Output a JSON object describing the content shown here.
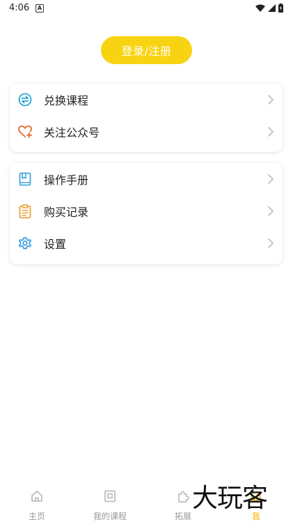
{
  "status_bar": {
    "time": "4:06",
    "notification_badge": "A"
  },
  "login": {
    "label": "登录/注册"
  },
  "card1": {
    "items": [
      {
        "label": "兑换课程",
        "icon": "exchange-icon"
      },
      {
        "label": "关注公众号",
        "icon": "heart-plus-icon"
      }
    ]
  },
  "card2": {
    "items": [
      {
        "label": "操作手册",
        "icon": "book-icon"
      },
      {
        "label": "购买记录",
        "icon": "clipboard-icon"
      },
      {
        "label": "设置",
        "icon": "gear-icon"
      }
    ]
  },
  "tabs": [
    {
      "label": "主页",
      "icon": "home-icon",
      "active": false
    },
    {
      "label": "我的课程",
      "icon": "course-icon",
      "active": false
    },
    {
      "label": "拓展",
      "icon": "puzzle-icon",
      "active": false
    },
    {
      "label": "我",
      "icon": "me-icon",
      "active": true
    }
  ],
  "watermark": "大玩客",
  "colors": {
    "accent": "#f8d312",
    "active_tab": "#f3b400",
    "exchange_icon": "#2aa6d6",
    "heart_icon": "#e3672f",
    "book_icon": "#46a7d9",
    "clipboard_icon": "#e8a43a",
    "gear_icon": "#2f9de0",
    "inactive_tab": "#b5b5b5"
  }
}
